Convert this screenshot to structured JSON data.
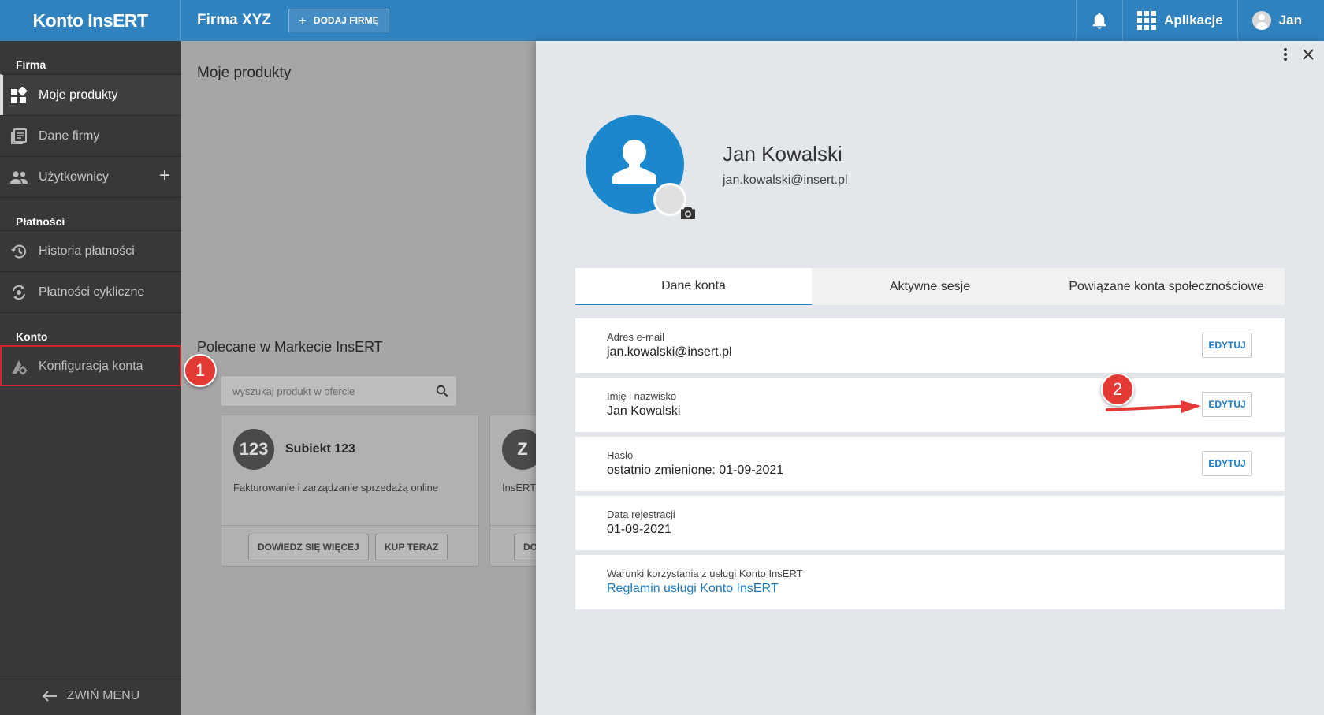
{
  "topbar": {
    "brand": "Konto InsERT",
    "company": "Firma XYZ",
    "add_company": "DODAJ FIRMĘ",
    "apps": "Aplikacje",
    "user": "Jan"
  },
  "sidebar": {
    "sections": [
      {
        "title": "Firma",
        "items": [
          "Moje produkty",
          "Dane firmy",
          "Użytkownicy"
        ]
      },
      {
        "title": "Płatności",
        "items": [
          "Historia płatności",
          "Płatności cykliczne"
        ]
      },
      {
        "title": "Konto",
        "items": [
          "Konfiguracja konta"
        ]
      }
    ],
    "collapse": "ZWIŃ MENU"
  },
  "main": {
    "title": "Moje produkty",
    "recommended": "Polecane w Markecie InsERT",
    "search_placeholder": "wyszukaj produkt w ofercie",
    "cards": [
      {
        "logo": "123",
        "name": "Subiekt 123",
        "desc": "Fakturowanie i zarządzanie sprzedażą online",
        "btn_more": "DOWIEDZ SIĘ WIĘCEJ",
        "btn_buy": "KUP TERAZ"
      },
      {
        "logo": "Z",
        "desc": "InsERT",
        "btn_more": "DO"
      }
    ]
  },
  "profile": {
    "name": "Jan Kowalski",
    "email": "jan.kowalski@insert.pl",
    "tabs": [
      "Dane konta",
      "Aktywne sesje",
      "Powiązane konta społecznościowe"
    ],
    "rows": [
      {
        "label": "Adres e-mail",
        "value": "jan.kowalski@insert.pl",
        "edit": "EDYTUJ"
      },
      {
        "label": "Imię i nazwisko",
        "value": "Jan Kowalski",
        "edit": "EDYTUJ"
      },
      {
        "label": "Hasło",
        "value": "ostatnio zmienione: 01-09-2021",
        "edit": "EDYTUJ"
      },
      {
        "label": "Data rejestracji",
        "value": "01-09-2021"
      },
      {
        "label": "Warunki korzystania z usługi Konto InsERT",
        "value": "Reglamin usługi Konto InsERT"
      }
    ]
  },
  "markers": [
    "1",
    "2"
  ],
  "colors": {
    "topbar": "#3082bf",
    "accent": "#1b87cc",
    "sidebar": "#383838",
    "marker": "#e53935"
  }
}
